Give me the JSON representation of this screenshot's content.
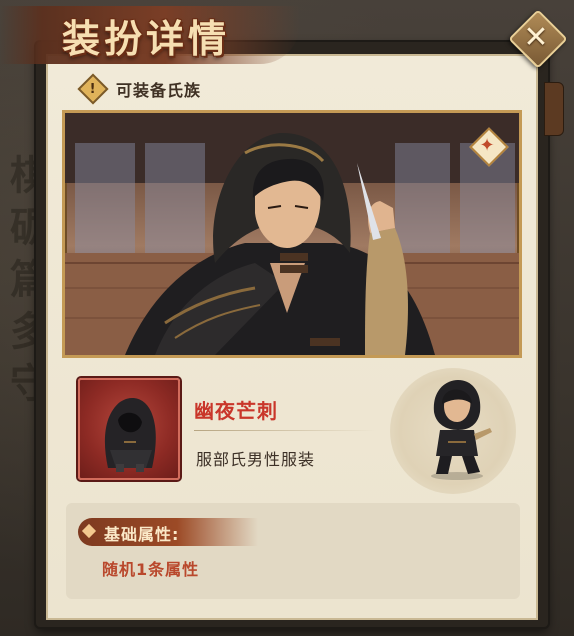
{
  "header": {
    "title": "装扮详情"
  },
  "clan": {
    "icon": "warning-icon",
    "label": "可装备氏族"
  },
  "costume": {
    "name": "幽夜芒刺",
    "description": "服部氏男性服装",
    "icon": "hooded-ninja-costume-icon"
  },
  "attributes": {
    "header": "基础属性:",
    "value": "随机1条属性"
  },
  "background_calligraphy": [
    "棋",
    "砺",
    "篇",
    "多",
    "守"
  ],
  "colors": {
    "name_red": "#c9362a",
    "attr_red": "#b9482c",
    "panel": "#f1ead8",
    "gold_border": "#c49a55"
  }
}
